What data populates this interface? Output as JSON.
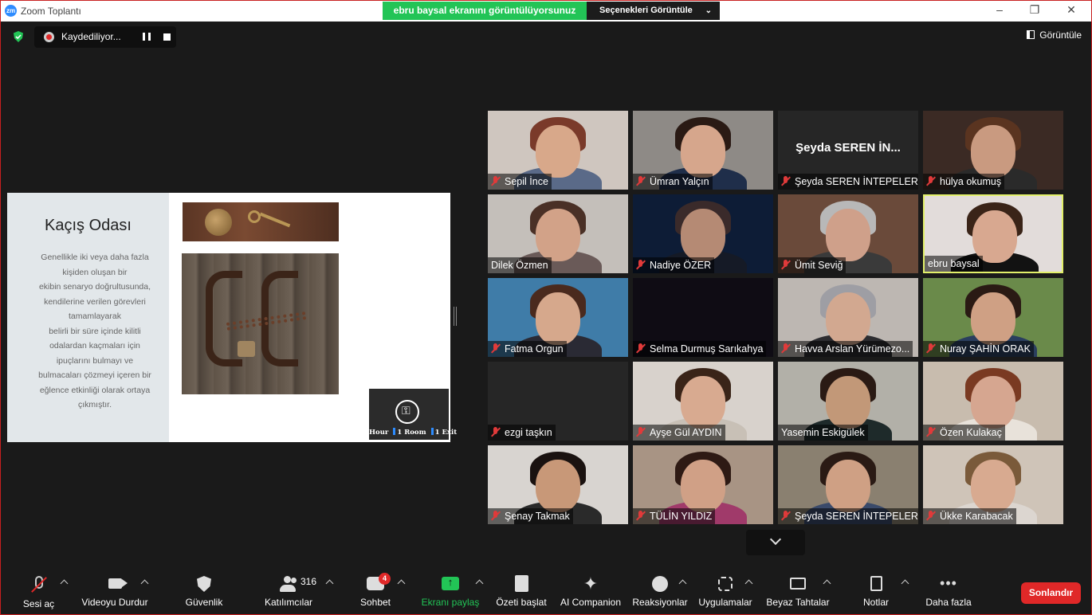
{
  "window": {
    "title": "Zoom Toplantı",
    "logo": "zm"
  },
  "share_banner": {
    "text": "ebru baysal ekranını görüntülüyorsunuz",
    "options_label": "Seçenekleri Görüntüle"
  },
  "recording": {
    "label": "Kaydediliyor..."
  },
  "view_button": {
    "label": "Görüntüle"
  },
  "slide": {
    "title": "Kaçış Odası",
    "body_lines": [
      "Genellikle iki veya daha fazla",
      "kişiden oluşan bir",
      "ekibin senaryo doğrultusunda,",
      "kendilerine verilen görevleri",
      "tamamlayarak",
      "belirli bir süre içinde kilitli",
      "odalardan kaçmaları için",
      "ipuçlarını bulmayı ve",
      "bulmacaları çözmeyi içeren bir",
      "eğlence etkinliği olarak ortaya",
      "çıkmıştır."
    ],
    "logo_strip": [
      "Hour",
      "1 Room",
      "1 Exit"
    ]
  },
  "participants": [
    {
      "name": "Sepil İnce",
      "muted": true
    },
    {
      "name": "Ümran Yalçın",
      "muted": true
    },
    {
      "name": "Şeyda SEREN İNTEPELER",
      "muted": true,
      "big_label": "Şeyda SEREN İN..."
    },
    {
      "name": "hülya okumuş",
      "muted": true
    },
    {
      "name": "Dilek Özmen",
      "muted": false
    },
    {
      "name": "Nadiye ÖZER",
      "muted": true
    },
    {
      "name": "Ümit Seviğ",
      "muted": true
    },
    {
      "name": "ebru baysal",
      "muted": false,
      "active": true
    },
    {
      "name": "Fatma Orgun",
      "muted": true
    },
    {
      "name": "Selma Durmuş Sarıkahya",
      "muted": true
    },
    {
      "name": "Havva Arslan Yürümezo...",
      "muted": true
    },
    {
      "name": "Nuray ŞAHİN ORAK",
      "muted": true
    },
    {
      "name": "ezgi taşkın",
      "muted": true
    },
    {
      "name": "Ayşe Gül AYDIN",
      "muted": true
    },
    {
      "name": "Yasemin Eskigülek",
      "muted": false
    },
    {
      "name": "Özen Kulakaç",
      "muted": true
    },
    {
      "name": "Şenay Takmak",
      "muted": true
    },
    {
      "name": "TÜLİN YILDIZ",
      "muted": true
    },
    {
      "name": "Şeyda SEREN İNTEPELER",
      "muted": true
    },
    {
      "name": "Ükke Karabacak",
      "muted": true
    }
  ],
  "toolbar": {
    "audio": "Sesi aç",
    "video": "Videoyu Durdur",
    "security": "Güvenlik",
    "participants": "Katılımcılar",
    "participants_count": "316",
    "chat": "Sohbet",
    "chat_badge": "4",
    "share": "Ekranı paylaş",
    "summary": "Özeti başlat",
    "ai": "AI Companion",
    "reactions": "Reaksiyonlar",
    "apps": "Uygulamalar",
    "whiteboard": "Beyaz Tahtalar",
    "notes": "Notlar",
    "more": "Daha fazla",
    "end": "Sonlandır"
  },
  "colors": {
    "accent_green": "#22c456",
    "end_red": "#e02828",
    "active_border": "#e2f06a"
  }
}
